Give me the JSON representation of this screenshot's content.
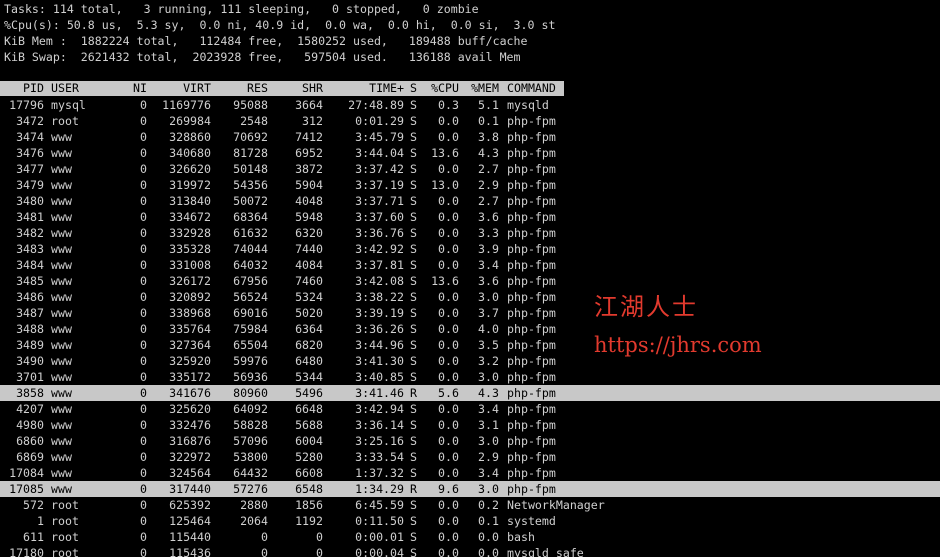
{
  "summary": {
    "tasks": "Tasks: 114 total,   3 running, 111 sleeping,   0 stopped,   0 zombie",
    "cpu": "%Cpu(s): 50.8 us,  5.3 sy,  0.0 ni, 40.9 id,  0.0 wa,  0.0 hi,  0.0 si,  3.0 st",
    "mem": "KiB Mem :  1882224 total,   112484 free,  1580252 used,   189488 buff/cache",
    "swap": "KiB Swap:  2621432 total,  2023928 free,   597504 used.   136188 avail Mem"
  },
  "columns": {
    "pid": "PID",
    "user": "USER",
    "ni": "NI",
    "virt": "VIRT",
    "res": "RES",
    "shr": "SHR",
    "time": "TIME+",
    "s": "S",
    "cpu": "%CPU",
    "mem": "%MEM",
    "command": "COMMAND"
  },
  "processes": [
    {
      "pid": "17796",
      "user": "mysql",
      "ni": "0",
      "virt": "1169776",
      "res": "95088",
      "shr": "3664",
      "time": "27:48.89",
      "s": "S",
      "cpu": "0.3",
      "mem": "5.1",
      "command": "mysqld",
      "selected": false
    },
    {
      "pid": "3472",
      "user": "root",
      "ni": "0",
      "virt": "269984",
      "res": "2548",
      "shr": "312",
      "time": "0:01.29",
      "s": "S",
      "cpu": "0.0",
      "mem": "0.1",
      "command": "php-fpm",
      "selected": false
    },
    {
      "pid": "3474",
      "user": "www",
      "ni": "0",
      "virt": "328860",
      "res": "70692",
      "shr": "7412",
      "time": "3:45.79",
      "s": "S",
      "cpu": "0.0",
      "mem": "3.8",
      "command": "php-fpm",
      "selected": false
    },
    {
      "pid": "3476",
      "user": "www",
      "ni": "0",
      "virt": "340680",
      "res": "81728",
      "shr": "6952",
      "time": "3:44.04",
      "s": "S",
      "cpu": "13.6",
      "mem": "4.3",
      "command": "php-fpm",
      "selected": false
    },
    {
      "pid": "3477",
      "user": "www",
      "ni": "0",
      "virt": "326620",
      "res": "50148",
      "shr": "3872",
      "time": "3:37.42",
      "s": "S",
      "cpu": "0.0",
      "mem": "2.7",
      "command": "php-fpm",
      "selected": false
    },
    {
      "pid": "3479",
      "user": "www",
      "ni": "0",
      "virt": "319972",
      "res": "54356",
      "shr": "5904",
      "time": "3:37.19",
      "s": "S",
      "cpu": "13.0",
      "mem": "2.9",
      "command": "php-fpm",
      "selected": false
    },
    {
      "pid": "3480",
      "user": "www",
      "ni": "0",
      "virt": "313840",
      "res": "50072",
      "shr": "4048",
      "time": "3:37.71",
      "s": "S",
      "cpu": "0.0",
      "mem": "2.7",
      "command": "php-fpm",
      "selected": false
    },
    {
      "pid": "3481",
      "user": "www",
      "ni": "0",
      "virt": "334672",
      "res": "68364",
      "shr": "5948",
      "time": "3:37.60",
      "s": "S",
      "cpu": "0.0",
      "mem": "3.6",
      "command": "php-fpm",
      "selected": false
    },
    {
      "pid": "3482",
      "user": "www",
      "ni": "0",
      "virt": "332928",
      "res": "61632",
      "shr": "6320",
      "time": "3:36.76",
      "s": "S",
      "cpu": "0.0",
      "mem": "3.3",
      "command": "php-fpm",
      "selected": false
    },
    {
      "pid": "3483",
      "user": "www",
      "ni": "0",
      "virt": "335328",
      "res": "74044",
      "shr": "7440",
      "time": "3:42.92",
      "s": "S",
      "cpu": "0.0",
      "mem": "3.9",
      "command": "php-fpm",
      "selected": false
    },
    {
      "pid": "3484",
      "user": "www",
      "ni": "0",
      "virt": "331008",
      "res": "64032",
      "shr": "4084",
      "time": "3:37.81",
      "s": "S",
      "cpu": "0.0",
      "mem": "3.4",
      "command": "php-fpm",
      "selected": false
    },
    {
      "pid": "3485",
      "user": "www",
      "ni": "0",
      "virt": "326172",
      "res": "67956",
      "shr": "7460",
      "time": "3:42.08",
      "s": "S",
      "cpu": "13.6",
      "mem": "3.6",
      "command": "php-fpm",
      "selected": false
    },
    {
      "pid": "3486",
      "user": "www",
      "ni": "0",
      "virt": "320892",
      "res": "56524",
      "shr": "5324",
      "time": "3:38.22",
      "s": "S",
      "cpu": "0.0",
      "mem": "3.0",
      "command": "php-fpm",
      "selected": false
    },
    {
      "pid": "3487",
      "user": "www",
      "ni": "0",
      "virt": "338968",
      "res": "69016",
      "shr": "5020",
      "time": "3:39.19",
      "s": "S",
      "cpu": "0.0",
      "mem": "3.7",
      "command": "php-fpm",
      "selected": false
    },
    {
      "pid": "3488",
      "user": "www",
      "ni": "0",
      "virt": "335764",
      "res": "75984",
      "shr": "6364",
      "time": "3:36.26",
      "s": "S",
      "cpu": "0.0",
      "mem": "4.0",
      "command": "php-fpm",
      "selected": false
    },
    {
      "pid": "3489",
      "user": "www",
      "ni": "0",
      "virt": "327364",
      "res": "65504",
      "shr": "6820",
      "time": "3:44.96",
      "s": "S",
      "cpu": "0.0",
      "mem": "3.5",
      "command": "php-fpm",
      "selected": false
    },
    {
      "pid": "3490",
      "user": "www",
      "ni": "0",
      "virt": "325920",
      "res": "59976",
      "shr": "6480",
      "time": "3:41.30",
      "s": "S",
      "cpu": "0.0",
      "mem": "3.2",
      "command": "php-fpm",
      "selected": false
    },
    {
      "pid": "3701",
      "user": "www",
      "ni": "0",
      "virt": "335172",
      "res": "56936",
      "shr": "5344",
      "time": "3:40.85",
      "s": "S",
      "cpu": "0.0",
      "mem": "3.0",
      "command": "php-fpm",
      "selected": false
    },
    {
      "pid": "3858",
      "user": "www",
      "ni": "0",
      "virt": "341676",
      "res": "80960",
      "shr": "5496",
      "time": "3:41.46",
      "s": "R",
      "cpu": "5.6",
      "mem": "4.3",
      "command": "php-fpm",
      "selected": true
    },
    {
      "pid": "4207",
      "user": "www",
      "ni": "0",
      "virt": "325620",
      "res": "64092",
      "shr": "6648",
      "time": "3:42.94",
      "s": "S",
      "cpu": "0.0",
      "mem": "3.4",
      "command": "php-fpm",
      "selected": false
    },
    {
      "pid": "4980",
      "user": "www",
      "ni": "0",
      "virt": "332476",
      "res": "58828",
      "shr": "5688",
      "time": "3:36.14",
      "s": "S",
      "cpu": "0.0",
      "mem": "3.1",
      "command": "php-fpm",
      "selected": false
    },
    {
      "pid": "6860",
      "user": "www",
      "ni": "0",
      "virt": "316876",
      "res": "57096",
      "shr": "6004",
      "time": "3:25.16",
      "s": "S",
      "cpu": "0.0",
      "mem": "3.0",
      "command": "php-fpm",
      "selected": false
    },
    {
      "pid": "6869",
      "user": "www",
      "ni": "0",
      "virt": "322972",
      "res": "53800",
      "shr": "5280",
      "time": "3:33.54",
      "s": "S",
      "cpu": "0.0",
      "mem": "2.9",
      "command": "php-fpm",
      "selected": false
    },
    {
      "pid": "17084",
      "user": "www",
      "ni": "0",
      "virt": "324564",
      "res": "64432",
      "shr": "6608",
      "time": "1:37.32",
      "s": "S",
      "cpu": "0.0",
      "mem": "3.4",
      "command": "php-fpm",
      "selected": false
    },
    {
      "pid": "17085",
      "user": "www",
      "ni": "0",
      "virt": "317440",
      "res": "57276",
      "shr": "6548",
      "time": "1:34.29",
      "s": "R",
      "cpu": "9.6",
      "mem": "3.0",
      "command": "php-fpm",
      "selected": true
    },
    {
      "pid": "572",
      "user": "root",
      "ni": "0",
      "virt": "625392",
      "res": "2880",
      "shr": "1856",
      "time": "6:45.59",
      "s": "S",
      "cpu": "0.0",
      "mem": "0.2",
      "command": "NetworkManager",
      "selected": false
    },
    {
      "pid": "1",
      "user": "root",
      "ni": "0",
      "virt": "125464",
      "res": "2064",
      "shr": "1192",
      "time": "0:11.50",
      "s": "S",
      "cpu": "0.0",
      "mem": "0.1",
      "command": "systemd",
      "selected": false
    },
    {
      "pid": "611",
      "user": "root",
      "ni": "0",
      "virt": "115440",
      "res": "0",
      "shr": "0",
      "time": "0:00.01",
      "s": "S",
      "cpu": "0.0",
      "mem": "0.0",
      "command": "bash",
      "selected": false
    },
    {
      "pid": "17180",
      "user": "root",
      "ni": "0",
      "virt": "115436",
      "res": "0",
      "shr": "0",
      "time": "0:00.04",
      "s": "S",
      "cpu": "0.0",
      "mem": "0.0",
      "command": "mysqld_safe",
      "selected": false
    }
  ],
  "watermark": {
    "line1": "江湖人士",
    "line2": "https://jhrs.com"
  },
  "colors": {
    "background": "#000000",
    "text": "#d0d0d0",
    "highlight": "#c8c8c8",
    "watermark": "#e23a2e"
  }
}
